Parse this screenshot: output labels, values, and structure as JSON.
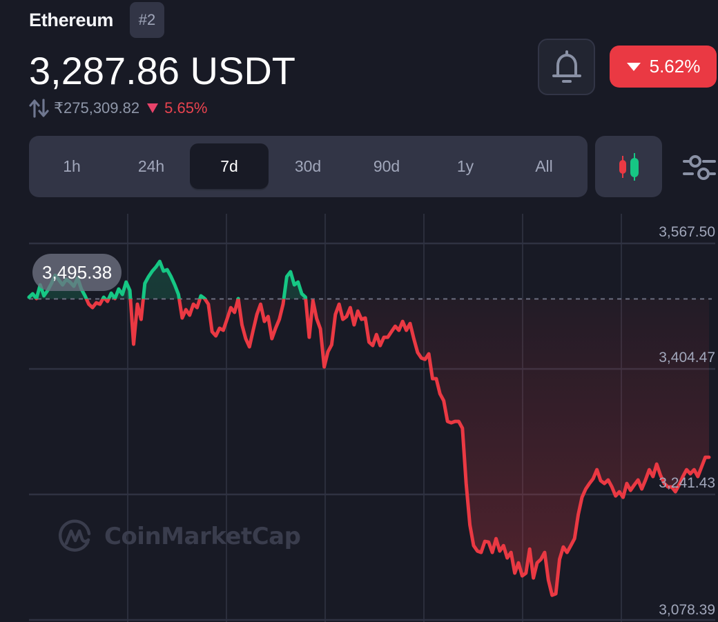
{
  "header": {
    "coin_name": "Ethereum",
    "rank": "#2",
    "price": "3,287.86 USDT",
    "inr_price": "₹275,309.82",
    "inr_change": "5.65%",
    "change_badge": "5.62%",
    "change_direction": "down",
    "icons": {
      "swap": "swap-arrows-icon",
      "bell": "bell-icon",
      "down": "triangle-down-icon"
    }
  },
  "range_tabs": [
    {
      "label": "1h",
      "active": false
    },
    {
      "label": "24h",
      "active": false
    },
    {
      "label": "7d",
      "active": true
    },
    {
      "label": "30d",
      "active": false
    },
    {
      "label": "90d",
      "active": false
    },
    {
      "label": "1y",
      "active": false
    },
    {
      "label": "All",
      "active": false
    }
  ],
  "toolbar": {
    "candle_icon": "candlestick-icon",
    "settings_icon": "sliders-icon"
  },
  "colors": {
    "up": "#16c784",
    "down": "#ea3943",
    "background": "#181a25",
    "panel": "#323546",
    "muted_text": "#a1a7bb"
  },
  "watermark": {
    "text": "CoinMarketCap"
  },
  "chart_data": {
    "type": "line",
    "title": "",
    "xlabel": "",
    "ylabel": "",
    "period": "7d",
    "baseline_label": "3,495.38",
    "baseline_value": 3495.38,
    "y_ticks": [
      3567.5,
      3404.47,
      3241.43,
      3078.39
    ],
    "y_tick_labels": [
      "3,567.50",
      "3,404.47",
      "3,241.43",
      "3,078.39"
    ],
    "ylim": [
      3078.39,
      3567.5
    ],
    "grid": true,
    "legend": "none",
    "values": [
      3497.6,
      3502.1,
      3495.8,
      3513.7,
      3499.4,
      3506.5,
      3515.5,
      3526.2,
      3520.0,
      3513.7,
      3520.9,
      3517.3,
      3511.9,
      3522.6,
      3508.3,
      3499.4,
      3488.6,
      3484.1,
      3490.4,
      3488.6,
      3497.6,
      3492.2,
      3502.9,
      3495.8,
      3508.3,
      3501.2,
      3517.3,
      3506.5,
      3436.6,
      3488.6,
      3468.9,
      3515.5,
      3524.4,
      3531.6,
      3537.0,
      3544.1,
      3531.6,
      3533.4,
      3524.4,
      3513.7,
      3501.2,
      3470.7,
      3481.5,
      3474.3,
      3488.6,
      3484.1,
      3499.4,
      3495.8,
      3488.6,
      3452.8,
      3447.4,
      3457.3,
      3454.6,
      3468.9,
      3484.1,
      3477.9,
      3495.8,
      3461.7,
      3443.8,
      3433.1,
      3454.6,
      3475.2,
      3488.6,
      3466.2,
      3472.5,
      3443.8,
      3457.3,
      3468.9,
      3488.6,
      3524.4,
      3530.7,
      3513.7,
      3517.3,
      3502.1,
      3497.6,
      3445.6,
      3493.1,
      3469.8,
      3456.4,
      3407.1,
      3426.8,
      3435.8,
      3475.2,
      3488.6,
      3468.9,
      3472.5,
      3484.1,
      3461.7,
      3479.6,
      3468.9,
      3470.7,
      3439.3,
      3434.8,
      3449.2,
      3434.8,
      3445.6,
      3445.6,
      3452.8,
      3459.9,
      3454.6,
      3466.2,
      3454.6,
      3463.5,
      3443.8,
      3425.9,
      3418.7,
      3416.9,
      3424.1,
      3391.8,
      3391.8,
      3372.1,
      3363.2,
      3336.3,
      3334.5,
      3336.3,
      3336.3,
      3327.4,
      3255.7,
      3201.9,
      3175.0,
      3167.9,
      3166.1,
      3180.4,
      3179.5,
      3166.1,
      3184.0,
      3167.9,
      3175.0,
      3158.9,
      3166.1,
      3139.2,
      3152.6,
      3135.6,
      3139.2,
      3170.5,
      3132.9,
      3152.6,
      3157.1,
      3166.1,
      3130.2,
      3110.5,
      3112.3,
      3157.1,
      3173.2,
      3166.1,
      3175.0,
      3184.0,
      3215.4,
      3237.7,
      3248.5,
      3255.7,
      3261.9,
      3273.6,
      3259.3,
      3255.7,
      3260.2,
      3251.2,
      3239.5,
      3244.9,
      3237.7,
      3255.7,
      3246.7,
      3253.9,
      3260.2,
      3248.5,
      3260.2,
      3273.6,
      3264.6,
      3280.8,
      3266.4,
      3255.7,
      3251.2,
      3251.2,
      3244.9,
      3253.9,
      3264.6,
      3273.6,
      3268.2,
      3273.6,
      3264.6,
      3277.2,
      3289.7,
      3289.7
    ]
  }
}
